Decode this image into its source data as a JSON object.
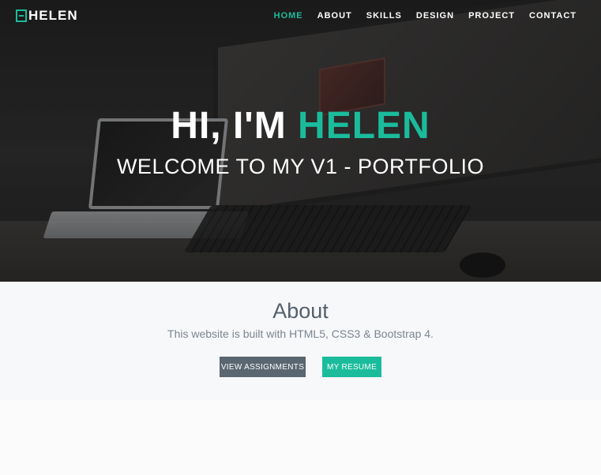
{
  "nav": {
    "logo_text": "HELEN",
    "items": [
      {
        "label": "HOME",
        "active": true
      },
      {
        "label": "ABOUT"
      },
      {
        "label": "SKILLS"
      },
      {
        "label": "DESIGN"
      },
      {
        "label": "PROJECT"
      },
      {
        "label": "CONTACT"
      }
    ]
  },
  "hero": {
    "title_prefix": "HI, I'M",
    "title_name": "HELEN",
    "subtitle": "WELCOME TO MY V1 - PORTFOLIO"
  },
  "about": {
    "title": "About",
    "description": "This website is built with HTML5, CSS3 & Bootstrap 4.",
    "buttons": {
      "assignments": "VIEW ASSIGNMENTS",
      "resume": "MY RESUME"
    }
  },
  "colors": {
    "accent": "#1abc9c",
    "button_dark": "#5a6670",
    "background": "#f7f8fa"
  }
}
